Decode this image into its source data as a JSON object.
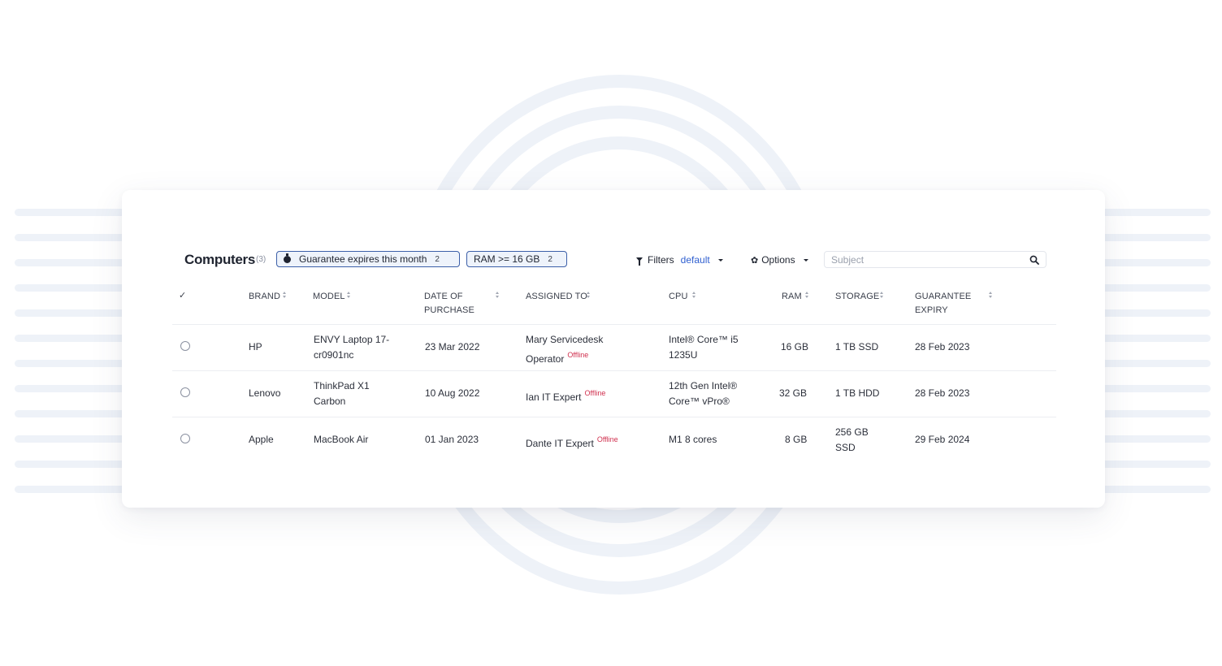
{
  "header": {
    "title": "Computers",
    "count": "(3)"
  },
  "chips": [
    {
      "label": "Guarantee expires this month",
      "count": "2",
      "icon": "stopwatch-icon"
    },
    {
      "label": "RAM >= 16 GB",
      "count": "2"
    }
  ],
  "filters": {
    "label": "Filters",
    "value": "default"
  },
  "options": {
    "label": "Options"
  },
  "search": {
    "placeholder": "Subject",
    "value": ""
  },
  "table": {
    "select_all": "✓",
    "columns": {
      "brand": "BRAND",
      "model": "MODEL",
      "date_l1": "DATE OF",
      "date_l2": "PURCHASE",
      "assigned": "ASSIGNED TO",
      "cpu": "CPU",
      "ram": "RAM",
      "storage": "STORAGE",
      "guarantee_l1": "GUARANTEE",
      "guarantee_l2": "EXPIRY"
    },
    "rows": [
      {
        "brand": "HP",
        "model_l1": "ENVY Laptop 17-",
        "model_l2": "cr0901nc",
        "date": "23 Mar 2022",
        "assigned_l1": "Mary Servicedesk",
        "assigned_l2": "Operator",
        "status": "Offline",
        "cpu_l1": "Intel® Core™ i5",
        "cpu_l2": "1235U",
        "ram": "16 GB",
        "storage": "1 TB SSD",
        "guarantee": "28 Feb 2023"
      },
      {
        "brand": "Lenovo",
        "model_l1": "ThinkPad X1",
        "model_l2": "Carbon",
        "date": "10 Aug 2022",
        "assigned": "Ian IT Expert",
        "status": "Offline",
        "cpu_l1": "12th Gen Intel®",
        "cpu_l2": "Core™ vPro®",
        "ram": "32 GB",
        "storage": "1 TB HDD",
        "guarantee": "28 Feb 2023"
      },
      {
        "brand": "Apple",
        "model": "MacBook Air",
        "date": "01 Jan 2023",
        "assigned": "Dante IT Expert",
        "status": "Offline",
        "cpu": "M1 8 cores",
        "ram": "8 GB",
        "storage_l1": "256 GB",
        "storage_l2": "SSD",
        "guarantee": "29 Feb 2024"
      }
    ]
  },
  "colors": {
    "accent": "#2f5fd0",
    "chip_border": "#3c5fa8",
    "offline": "#d0314f",
    "decoration": "#eef2f8"
  }
}
